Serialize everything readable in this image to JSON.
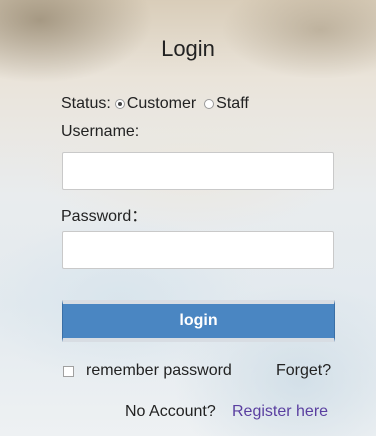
{
  "form": {
    "title": "Login",
    "status_label": "Status:",
    "status_options": [
      {
        "label": "Customer",
        "selected": true
      },
      {
        "label": "Staff",
        "selected": false
      }
    ],
    "username_label": "Username:",
    "username_value": "",
    "password_label": "Password：",
    "password_value": "",
    "login_label": "login",
    "remember_label": "remember password",
    "remember_checked": false,
    "forget_label": "Forget?",
    "no_account_label": "No Account?",
    "register_label": "Register here"
  },
  "colors": {
    "button_bg": "#4a86c2",
    "link": "#5a3fa0"
  }
}
